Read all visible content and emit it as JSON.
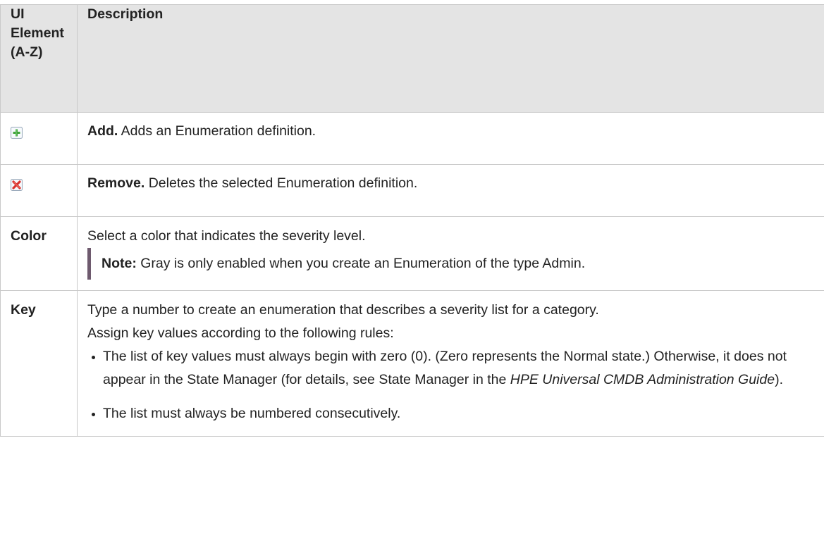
{
  "header": {
    "col1_line1": "UI",
    "col1_line2": "Element",
    "col1_line3": "(A-Z)",
    "col2": "Description"
  },
  "rows": {
    "add": {
      "icon": "add-plus-icon",
      "desc_bold": "Add.",
      "desc_text": " Adds an Enumeration definition."
    },
    "remove": {
      "icon": "remove-x-icon",
      "desc_bold": "Remove.",
      "desc_text": " Deletes the selected Enumeration definition."
    },
    "color": {
      "element": "Color",
      "desc": "Select a color that indicates the severity level.",
      "note_label": "Note:",
      "note_text": "  Gray is only enabled when you create an Enumeration of the type Admin."
    },
    "key": {
      "element": "Key",
      "desc1": "Type a number to create an enumeration that describes a severity list for a category.",
      "desc2": "Assign key values according to the following rules:",
      "bullet1_a": "The list of key values must always begin with zero (0). (Zero represents the Normal state.) Otherwise, it does not appear in the State Manager (for details, see State Manager in the ",
      "bullet1_italic": "HPE Universal CMDB Administration Guide",
      "bullet1_b": ").",
      "bullet2": "The list must always be numbered consecutively."
    }
  },
  "colors": {
    "header_bg": "#e4e4e4",
    "border": "#c9c9c9",
    "note_bar": "#6e5a6e",
    "add_icon_green": "#3fa33a",
    "remove_icon_red": "#d8312d"
  }
}
